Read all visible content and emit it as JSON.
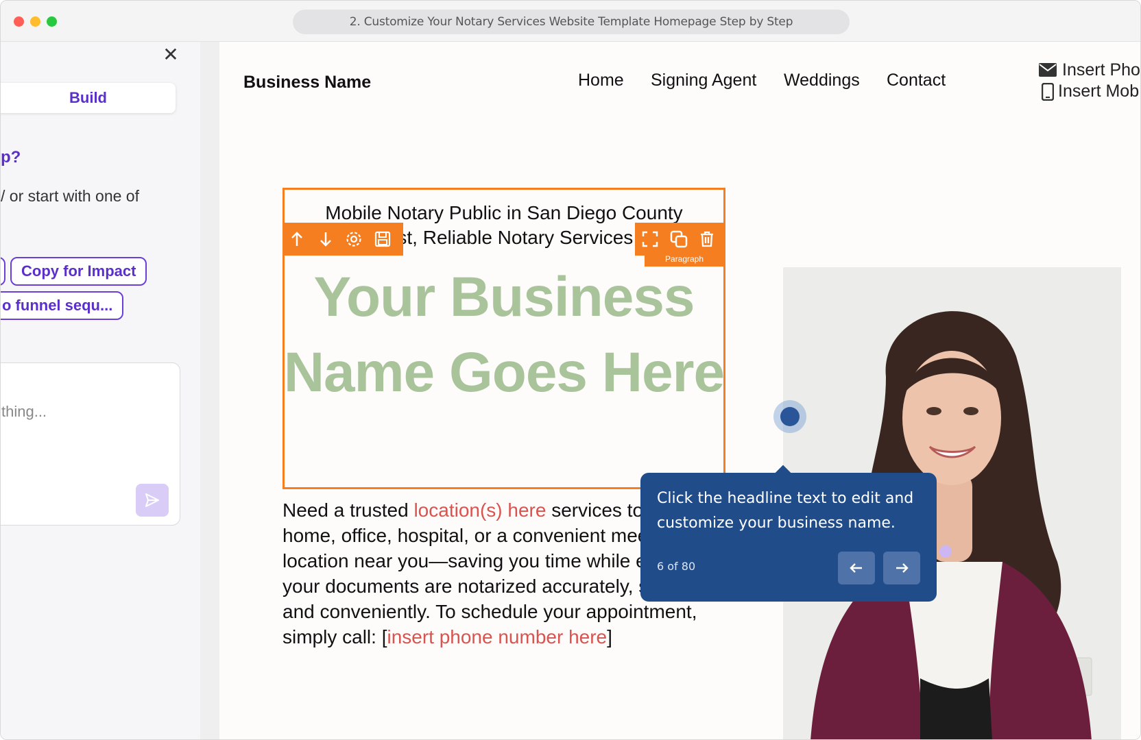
{
  "window": {
    "title": "2. Customize Your Notary Services Website Template Homepage Step by Step"
  },
  "left_panel": {
    "close_icon": "close-icon",
    "build_tab": "Build",
    "question": "p?",
    "help_text": "/ or start with one of",
    "chips": [
      "",
      "Copy for Impact",
      "o funnel sequ..."
    ],
    "chat_placeholder": "thing...",
    "send_icon": "send-icon",
    "accent_color": "#5b2fc9"
  },
  "site": {
    "brand": "Business Name",
    "nav": [
      "Home",
      "Signing Agent",
      "Weddings",
      "Contact"
    ],
    "contact": {
      "phone_text": "Insert Pho",
      "mobile_text": "Insert Mob"
    },
    "hero": {
      "tagline_line1": "Mobile Notary Public in San Diego County",
      "tagline_line2": "Fast, Reliable Notary Services",
      "headline": "Your Business Name Goes Here",
      "element_label": "Paragraph",
      "body_1": "Need a trusted ",
      "body_red_1": "location(s) here",
      "body_2": " services to your home, office, hospital, or a convenient meeting location near you—saving you time while ensuring your documents are notarized accurately, securely, and conveniently. To schedule your appointment, simply call: [",
      "body_red_2": "insert phone number here",
      "body_3": "]"
    },
    "headline_color": "#a9c49a",
    "selection_color": "#f47e20"
  },
  "tooltip": {
    "text": "Click the headline text to edit and customize your business name.",
    "step": "6 of 80",
    "background": "#214c8a"
  }
}
